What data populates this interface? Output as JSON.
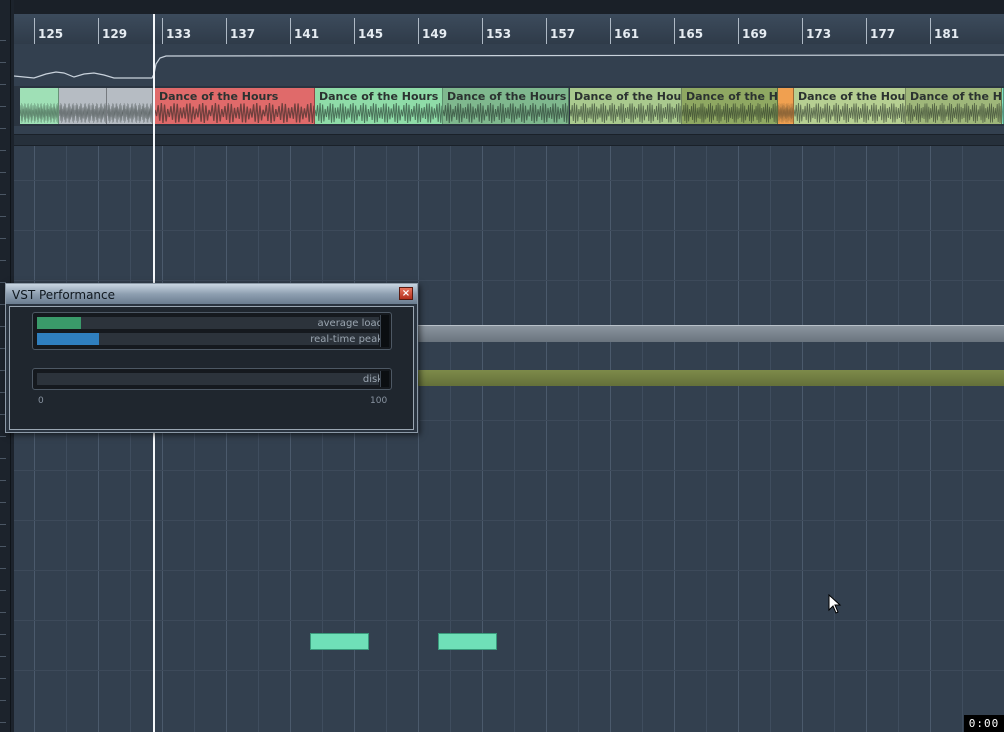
{
  "ruler": {
    "bars": [
      "125",
      "129",
      "133",
      "137",
      "141",
      "145",
      "149",
      "153",
      "157",
      "161",
      "165",
      "169",
      "173",
      "177",
      "181"
    ]
  },
  "audio_events": [
    {
      "label": "",
      "color": "#9fe0b6"
    },
    {
      "label": "",
      "color": "#b6bcc3"
    },
    {
      "label": "",
      "color": "#b6bcc3"
    },
    {
      "label": "Dance of the Hours",
      "color": "#e06a6a"
    },
    {
      "label": "Dance of the Hours",
      "color": "#8fdca8"
    },
    {
      "label": "Dance of the Hours",
      "color": "#7fb88e"
    },
    {
      "label": "Dance of the Hours",
      "color": "#a9c98e"
    },
    {
      "label": "Dance of the Hours",
      "color": "#8fa862"
    },
    {
      "label": "",
      "color": "#f0a050"
    },
    {
      "label": "Dance of the Hours",
      "color": "#b6cf92"
    },
    {
      "label": "Dance of the Hours",
      "color": "#9fb77a"
    },
    {
      "label": "",
      "color": "#7fe0c0"
    }
  ],
  "vst_performance": {
    "title": "VST Performance",
    "close_glyph": "×",
    "average_load": {
      "label": "average load",
      "value_percent": 13,
      "color": "#3a9a6a"
    },
    "realtime_peak": {
      "label": "real-time peak",
      "value_percent": 18,
      "color": "#2f7fbf"
    },
    "scale_min": "0",
    "scale_max": "100",
    "disk": {
      "label": "disk",
      "value_percent": 0
    }
  },
  "time_readout": "0:00",
  "icons": {
    "close": "close-icon",
    "cursor": "mouse-pointer-icon"
  }
}
